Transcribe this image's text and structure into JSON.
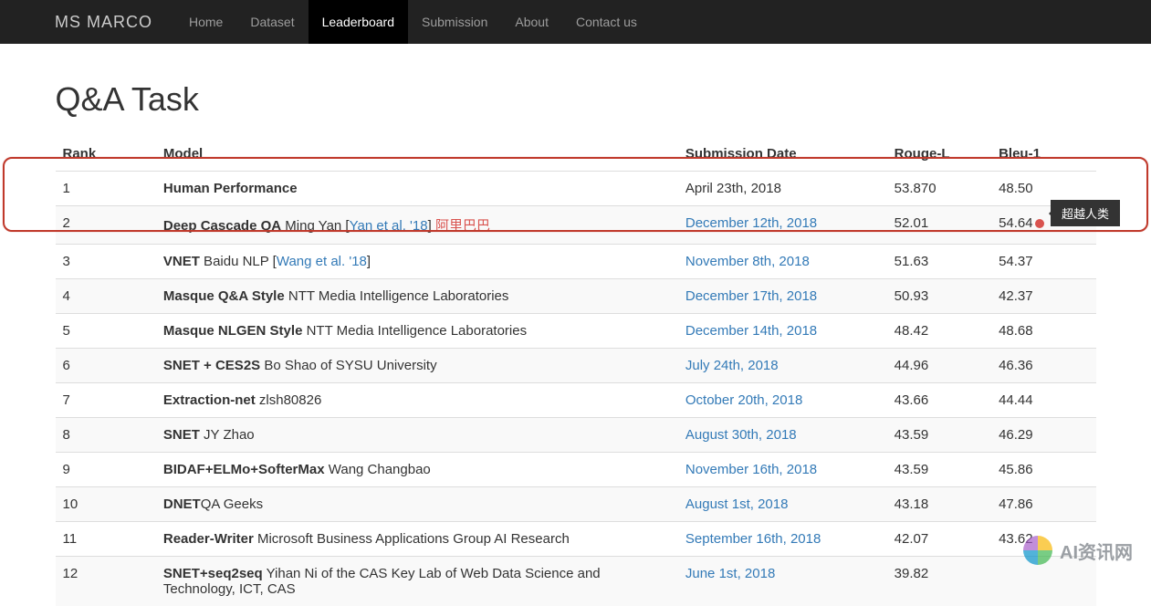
{
  "nav": {
    "brand": "MS MARCO",
    "items": [
      {
        "label": "Home",
        "active": false
      },
      {
        "label": "Dataset",
        "active": false
      },
      {
        "label": "Leaderboard",
        "active": true
      },
      {
        "label": "Submission",
        "active": false
      },
      {
        "label": "About",
        "active": false
      },
      {
        "label": "Contact us",
        "active": false
      }
    ]
  },
  "page_title": "Q&A Task",
  "columns": {
    "rank": "Rank",
    "model": "Model",
    "date": "Submission Date",
    "rouge": "Rouge-L",
    "bleu": "Bleu-1"
  },
  "rows": [
    {
      "rank": "1",
      "model_bold": "Human Performance",
      "model_rest": "",
      "ref": "",
      "extra": "",
      "date": "April 23th, 2018",
      "date_link": false,
      "rouge": "53.870",
      "bleu": "48.50"
    },
    {
      "rank": "2",
      "model_bold": "Deep Cascade QA",
      "model_rest": " Ming Yan [",
      "ref": "Yan et al. '18",
      "ref_close": "]   ",
      "extra": "阿里巴巴",
      "date": "December 12th, 2018",
      "date_link": true,
      "rouge": "52.01",
      "bleu": "54.64",
      "bleu_dot": true
    },
    {
      "rank": "3",
      "model_bold": "VNET",
      "model_rest": " Baidu NLP [",
      "ref": "Wang et al. '18",
      "ref_close": "]",
      "extra": "",
      "date": "November 8th, 2018",
      "date_link": true,
      "rouge": "51.63",
      "bleu": "54.37"
    },
    {
      "rank": "4",
      "model_bold": "Masque Q&A Style",
      "model_rest": " NTT Media Intelligence Laboratories",
      "ref": "",
      "extra": "",
      "date": "December 17th, 2018",
      "date_link": true,
      "rouge": "50.93",
      "bleu": "42.37"
    },
    {
      "rank": "5",
      "model_bold": "Masque NLGEN Style",
      "model_rest": " NTT Media Intelligence Laboratories",
      "ref": "",
      "extra": "",
      "date": "December 14th, 2018",
      "date_link": true,
      "rouge": "48.42",
      "bleu": "48.68"
    },
    {
      "rank": "6",
      "model_bold": "SNET + CES2S",
      "model_rest": " Bo Shao of SYSU University",
      "ref": "",
      "extra": "",
      "date": "July 24th, 2018",
      "date_link": true,
      "rouge": "44.96",
      "bleu": "46.36"
    },
    {
      "rank": "7",
      "model_bold": "Extraction-net",
      "model_rest": " zlsh80826",
      "ref": "",
      "extra": "",
      "date": "October 20th, 2018",
      "date_link": true,
      "rouge": "43.66",
      "bleu": "44.44"
    },
    {
      "rank": "8",
      "model_bold": "SNET",
      "model_rest": " JY Zhao",
      "ref": "",
      "extra": "",
      "date": "August 30th, 2018",
      "date_link": true,
      "rouge": "43.59",
      "bleu": "46.29"
    },
    {
      "rank": "9",
      "model_bold": "BIDAF+ELMo+SofterMax",
      "model_rest": " Wang Changbao",
      "ref": "",
      "extra": "",
      "date": "November 16th, 2018",
      "date_link": true,
      "rouge": "43.59",
      "bleu": "45.86"
    },
    {
      "rank": "10",
      "model_bold": "DNET",
      "model_rest": "QA Geeks",
      "ref": "",
      "extra": "",
      "date": "August 1st, 2018",
      "date_link": true,
      "rouge": "43.18",
      "bleu": "47.86"
    },
    {
      "rank": "11",
      "model_bold": "Reader-Writer",
      "model_rest": " Microsoft Business Applications Group AI Research",
      "ref": "",
      "extra": "",
      "date": "September 16th, 2018",
      "date_link": true,
      "rouge": "42.07",
      "bleu": "43.62"
    },
    {
      "rank": "12",
      "model_bold": "SNET+seq2seq",
      "model_rest": " Yihan Ni of the CAS Key Lab of Web Data Science and Technology, ICT, CAS",
      "ref": "",
      "extra": "",
      "date": "June 1st, 2018",
      "date_link": true,
      "rouge": "39.82",
      "bleu": ""
    }
  ],
  "tooltip_text": "超越人类",
  "watermark_text": "AI资讯网"
}
